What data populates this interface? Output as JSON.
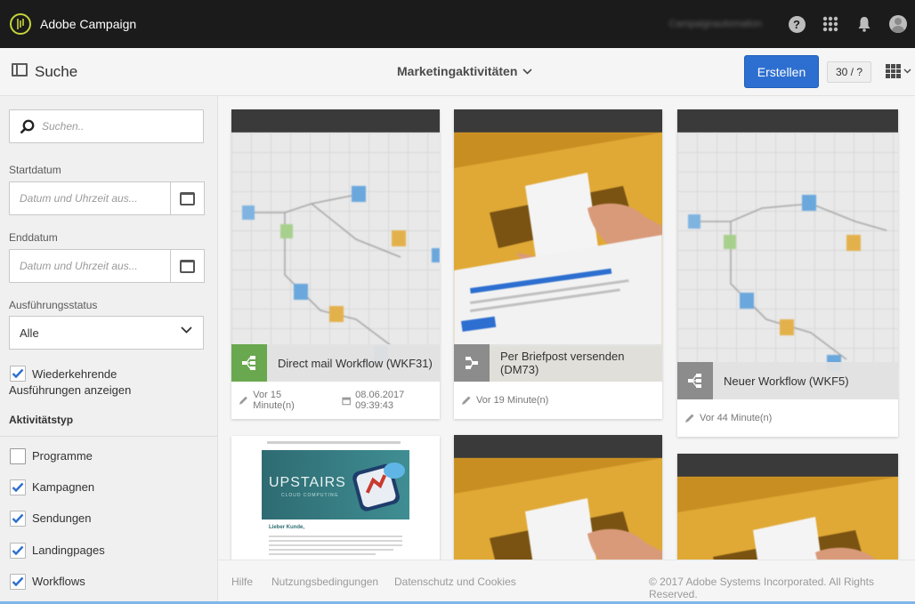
{
  "app": {
    "name": "Adobe Campaign",
    "org_name": "Campaignautomation"
  },
  "topbar": {
    "help_glyph": "?"
  },
  "subbar": {
    "search_title": "Suche",
    "view_title": "Marketingaktivitäten",
    "create_label": "Erstellen",
    "count_label": "30 / ?"
  },
  "sidebar": {
    "search_placeholder": "Suchen..",
    "start_label": "Startdatum",
    "start_placeholder": "Datum und Uhrzeit aus...",
    "end_label": "Enddatum",
    "end_placeholder": "Datum und Uhrzeit aus...",
    "status_label": "Ausführungsstatus",
    "status_value": "Alle",
    "recurring_label": "Wiederkehrende Ausführungen anzeigen",
    "recurring_checked": true,
    "activity_type_heading": "Aktivitätstyp",
    "types": [
      {
        "label": "Programme",
        "checked": false
      },
      {
        "label": "Kampagnen",
        "checked": true
      },
      {
        "label": "Sendungen",
        "checked": true
      },
      {
        "label": "Landingpages",
        "checked": true
      },
      {
        "label": "Workflows",
        "checked": true
      }
    ]
  },
  "cards": [
    {
      "title": "Direct mail Workflow (WKF31)",
      "time": "Vor 15 Minute(n)",
      "date": "08.06.2017 09:39:43",
      "kind": "workflow",
      "icon_color": "#6aa84f"
    },
    {
      "title": "Per Briefpost versenden (DM73)",
      "time": "Vor 19 Minute(n)",
      "kind": "delivery",
      "icon_color": "#8c8c8c"
    },
    {
      "title": "Neuer Workflow (WKF5)",
      "time": "Vor 44 Minute(n)",
      "kind": "workflow",
      "icon_color": "#8c8c8c"
    }
  ],
  "email_preview": {
    "brand": "UPSTAIRS",
    "brand_sub": "CLOUD COMPUTING",
    "greeting": "Lieber Kunde,"
  },
  "footer": {
    "help": "Hilfe",
    "terms": "Nutzungsbedingungen",
    "privacy": "Datenschutz und Cookies",
    "copyright": "© 2017 Adobe Systems Incorporated. All Rights Reserved."
  },
  "colors": {
    "accent": "#2d6fd0",
    "topbar": "#1b1b1b",
    "workflow_green": "#6aa84f"
  }
}
